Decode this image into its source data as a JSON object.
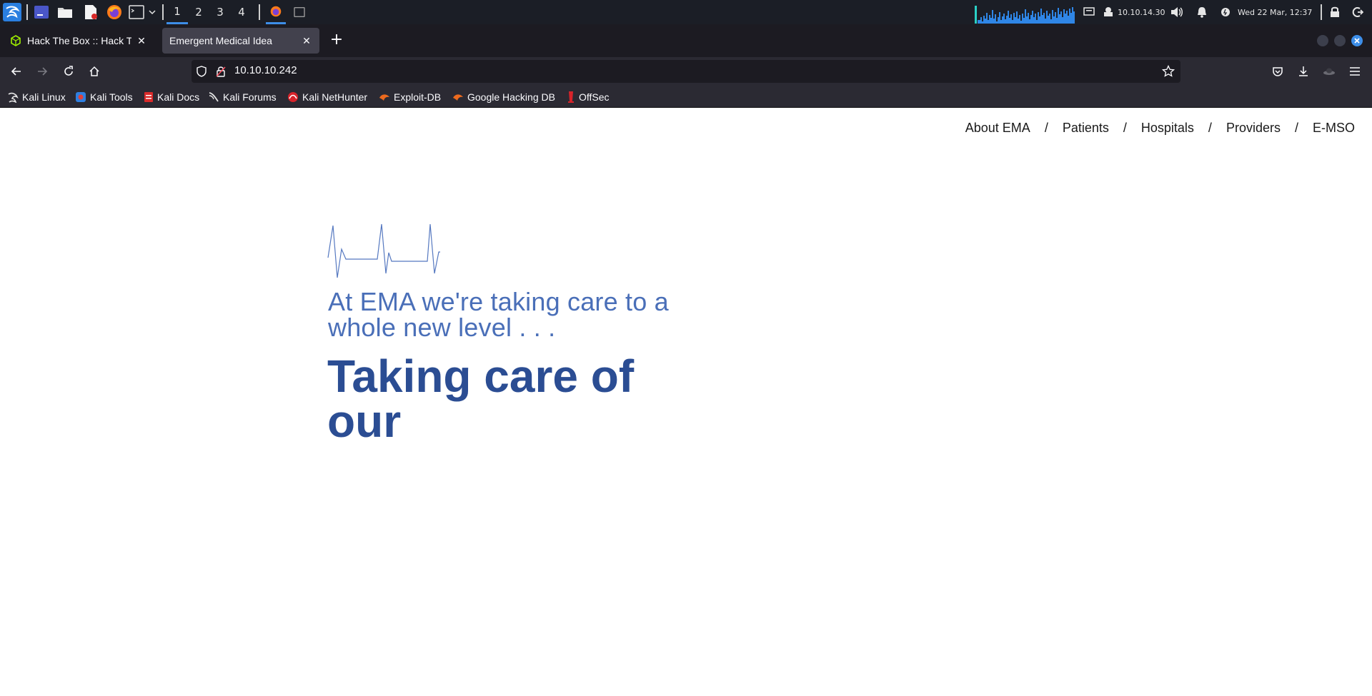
{
  "panel": {
    "workspaces": [
      "1",
      "2",
      "3",
      "4"
    ],
    "active_workspace": "1",
    "vpn_ip": "10.10.14.30",
    "datetime": "Wed 22 Mar, 12:37",
    "icons": [
      "kali-menu-icon",
      "terminal-icon",
      "file-manager-icon",
      "text-editor-icon",
      "firefox-icon",
      "terminal-icon",
      "dropdown-icon",
      "firefox-window-icon",
      "terminal-window-icon",
      "network-graph",
      "display-icon",
      "vpn-icon",
      "volume-icon",
      "notification-icon",
      "power-manager-icon",
      "lock-icon",
      "logout-icon"
    ]
  },
  "browser": {
    "tabs": [
      {
        "title": "Hack The Box :: Hack The Bo",
        "active": false
      },
      {
        "title": "Emergent Medical Idea",
        "active": true
      }
    ],
    "url": "10.10.10.242",
    "bookmarks": [
      "Kali Linux",
      "Kali Tools",
      "Kali Docs",
      "Kali Forums",
      "Kali NetHunter",
      "Exploit-DB",
      "Google Hacking DB",
      "OffSec"
    ]
  },
  "site": {
    "nav": [
      "About EMA",
      "Patients",
      "Hospitals",
      "Providers",
      "E-MSO"
    ],
    "nav_separator": "/",
    "tagline": "At EMA we're taking care to a whole new level . . .",
    "headline": "Taking care of our",
    "colors": {
      "tagline": "#4a6fb8",
      "headline": "#2b4d93",
      "pulse": "#5578c0"
    }
  }
}
